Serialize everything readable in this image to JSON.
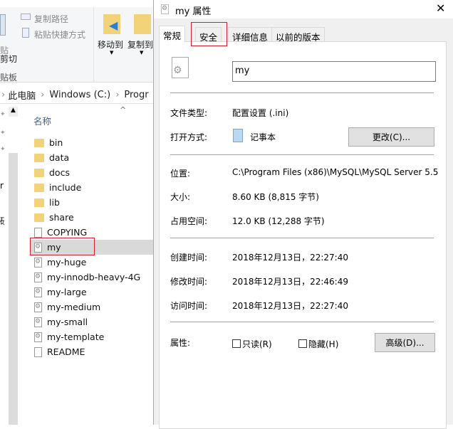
{
  "explorer": {
    "ribbon": {
      "copy_path": "复制路径",
      "paste_shortcut": "粘贴快捷方式",
      "paste_partial": "贴",
      "cut": "剪切",
      "clipboard_group": "贴板",
      "move_to": "移动到",
      "copy_to": "复制到"
    },
    "breadcrumb": [
      "此电脑",
      "Windows (C:)",
      "Progr"
    ],
    "nav_partial": [
      "r",
      "研"
    ],
    "column_name": "名称",
    "files": [
      {
        "name": "bin",
        "type": "folder"
      },
      {
        "name": "data",
        "type": "folder"
      },
      {
        "name": "docs",
        "type": "folder"
      },
      {
        "name": "include",
        "type": "folder"
      },
      {
        "name": "lib",
        "type": "folder"
      },
      {
        "name": "share",
        "type": "folder"
      },
      {
        "name": "COPYING",
        "type": "file"
      },
      {
        "name": "my",
        "type": "ini",
        "selected": true
      },
      {
        "name": "my-huge",
        "type": "ini"
      },
      {
        "name": "my-innodb-heavy-4G",
        "type": "ini"
      },
      {
        "name": "my-large",
        "type": "ini"
      },
      {
        "name": "my-medium",
        "type": "ini"
      },
      {
        "name": "my-small",
        "type": "ini"
      },
      {
        "name": "my-template",
        "type": "ini"
      },
      {
        "name": "README",
        "type": "file"
      }
    ]
  },
  "dialog": {
    "title": "my 属性",
    "tabs": [
      "常规",
      "安全",
      "详细信息",
      "以前的版本"
    ],
    "active_tab": "常规",
    "highlight_color": "#d0202a",
    "filename": "my",
    "file_type_label": "文件类型:",
    "file_type": "配置设置 (.ini)",
    "open_with_label": "打开方式:",
    "open_with": "记事本",
    "change_button": "更改(C)...",
    "location_label": "位置:",
    "location": "C:\\Program Files (x86)\\MySQL\\MySQL Server 5.5",
    "size_label": "大小:",
    "size": "8.60 KB (8,815 字节)",
    "size_on_disk_label": "占用空间:",
    "size_on_disk": "12.0 KB (12,288 字节)",
    "created_label": "创建时间:",
    "created": "2018年12月13日，22:27:40",
    "modified_label": "修改时间:",
    "modified": "2018年12月13日，22:46:49",
    "accessed_label": "访问时间:",
    "accessed": "2018年12月13日，22:27:40",
    "attributes_label": "属性:",
    "readonly_label": "只读(R)",
    "readonly_checked": false,
    "hidden_label": "隐藏(H)",
    "hidden_checked": false,
    "advanced_button": "高级(D)..."
  }
}
